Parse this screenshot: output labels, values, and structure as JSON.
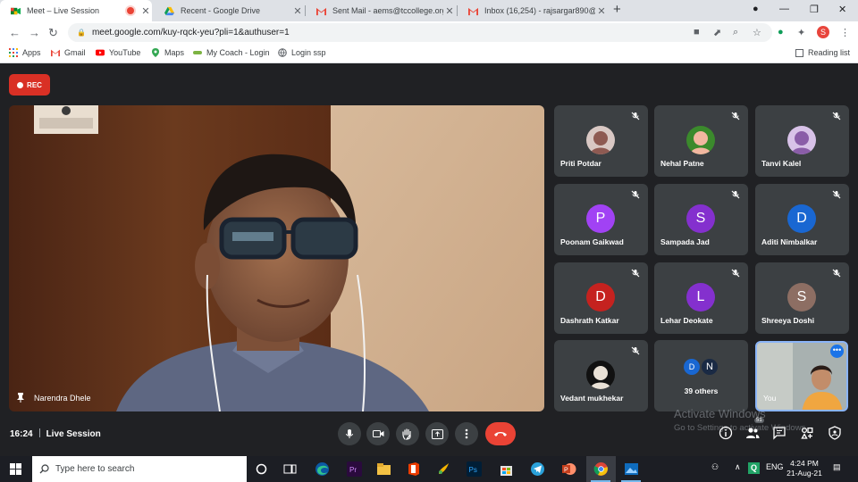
{
  "browser": {
    "tabs": [
      {
        "title": "Meet – Live Session",
        "active": true,
        "recording": true
      },
      {
        "title": "Recent - Google Drive",
        "active": false
      },
      {
        "title": "Sent Mail - aems@tccollege.org",
        "active": false
      },
      {
        "title": "Inbox (16,254) - rajsargar890@g",
        "active": false
      }
    ],
    "url": "meet.google.com/kuy-rqck-yeu?pli=1&authuser=1",
    "profile_initial": "S",
    "bookmarks": [
      "Apps",
      "Gmail",
      "YouTube",
      "Maps",
      "My Coach - Login",
      "Login ssp"
    ],
    "reading_list": "Reading list"
  },
  "meet": {
    "rec_label": "REC",
    "presenter": "Narendra Dhele",
    "participants": [
      {
        "name": "Priti Potdar",
        "avatar": "photo",
        "muted": true
      },
      {
        "name": "Nehal Patne",
        "avatar": "photo",
        "muted": true
      },
      {
        "name": "Tanvi Kalel",
        "avatar": "photo",
        "muted": true
      },
      {
        "name": "Poonam Gaikwad",
        "initial": "P",
        "color": "#a142f4",
        "muted": true
      },
      {
        "name": "Sampada Jad",
        "initial": "S",
        "color": "#8430ce",
        "muted": true
      },
      {
        "name": "Aditi Nimbalkar",
        "initial": "D",
        "color": "#1967d2",
        "muted": true
      },
      {
        "name": "Dashrath Katkar",
        "initial": "D",
        "color": "#c5221f",
        "muted": true
      },
      {
        "name": "Lehar Deokate",
        "initial": "L",
        "color": "#8430ce",
        "muted": true
      },
      {
        "name": "Shreeya Doshi",
        "initial": "S",
        "color": "#8d6e63",
        "muted": true
      },
      {
        "name": "Vedant mukhekar",
        "avatar": "photo",
        "muted": true
      }
    ],
    "others_label": "39 others",
    "others_initials": [
      "D",
      "N"
    ],
    "self_label": "You",
    "time": "16:24",
    "meeting_name": "Live Session",
    "people_count": "51"
  },
  "watermark": {
    "title": "Activate Windows",
    "subtitle": "Go to Settings to activate Windows."
  },
  "taskbar": {
    "search_placeholder": "Type here to search",
    "lang": "ENG",
    "time": "4:24 PM",
    "date": "21-Aug-21"
  }
}
